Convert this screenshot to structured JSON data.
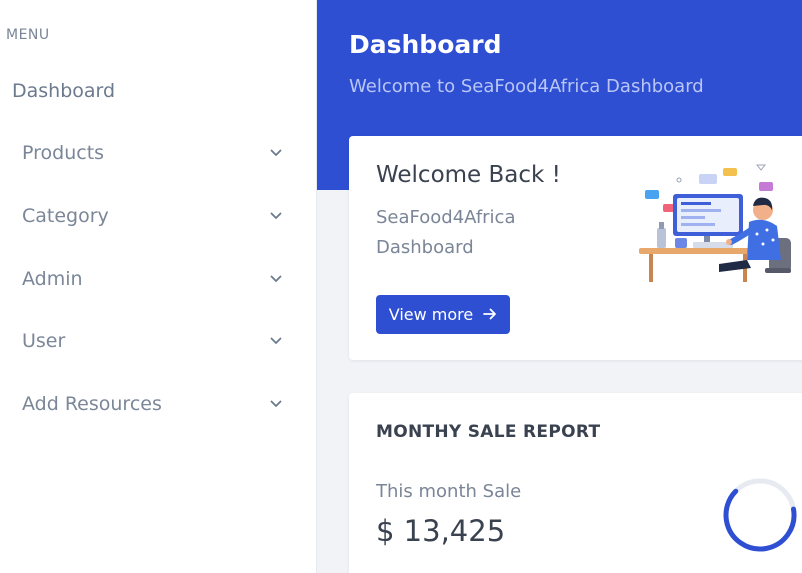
{
  "sidebar": {
    "menu_title": "MENU",
    "dashboard": "Dashboard",
    "items": [
      {
        "label": "Products"
      },
      {
        "label": "Category"
      },
      {
        "label": "Admin"
      },
      {
        "label": "User"
      },
      {
        "label": "Add Resources"
      }
    ]
  },
  "header": {
    "title": "Dashboard",
    "subtitle": "Welcome to SeaFood4Africa Dashboard"
  },
  "welcome_card": {
    "title": "Welcome Back !",
    "line1": "SeaFood4Africa",
    "line2": "Dashboard",
    "button_label": "View more"
  },
  "sales_card": {
    "title": "MONTHY SALE REPORT",
    "label": "This month Sale",
    "value": "$ 13,425",
    "progress": 0.65
  },
  "icons": {
    "chevron": "chevron-down-icon",
    "arrow": "arrow-right-icon"
  },
  "colors": {
    "primary": "#2f4fd3",
    "header_sub": "#b9c6f5",
    "muted": "#7a8597"
  }
}
